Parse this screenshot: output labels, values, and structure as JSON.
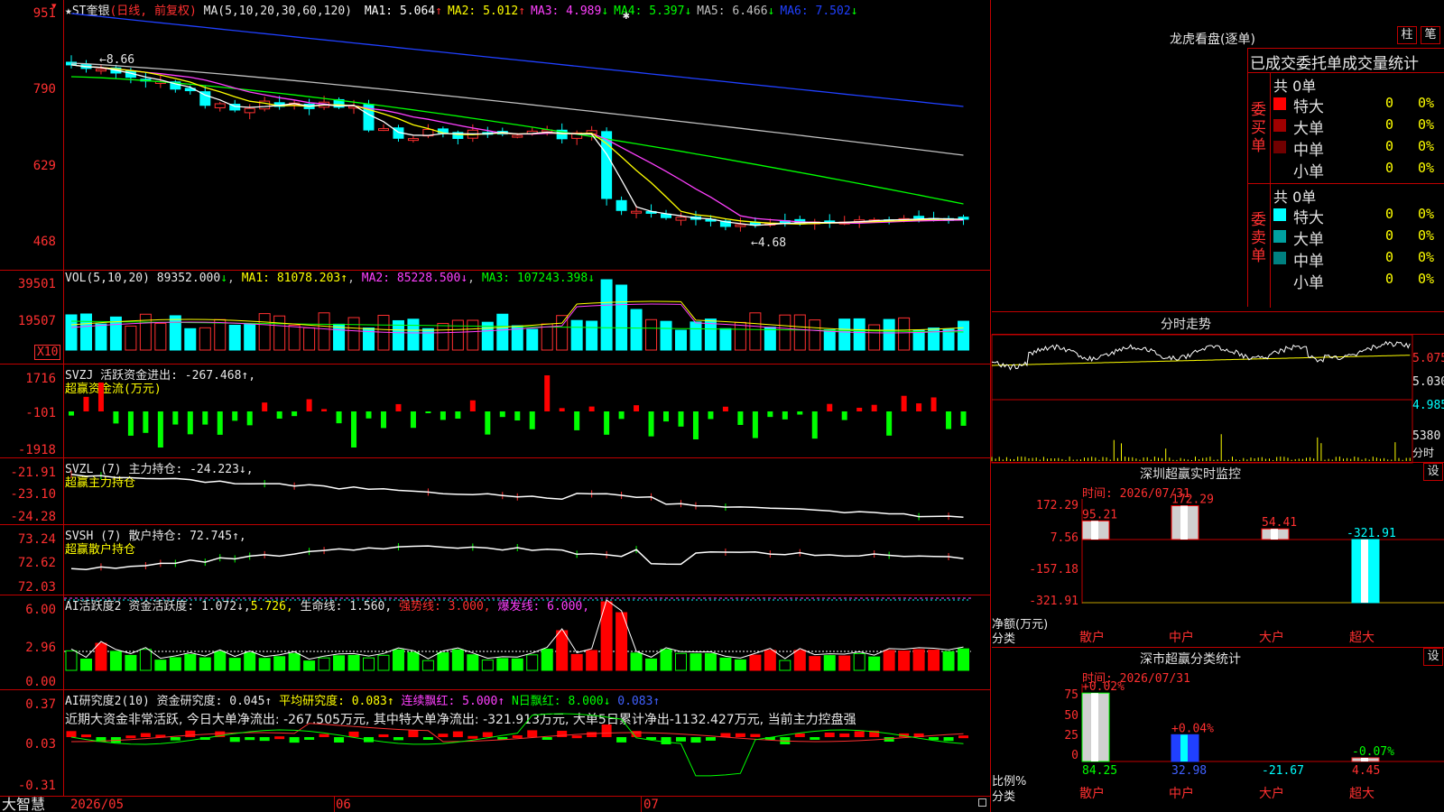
{
  "main_chart": {
    "stock_name": "★ST奎银",
    "period_tag": "(日线, 前复权)",
    "ma_params": "MA(5,10,20,30,60,120)",
    "ma_values": [
      {
        "label": "MA1:",
        "value": "5.064",
        "arrow": "↑",
        "color": "#ffffff"
      },
      {
        "label": "MA2:",
        "value": "5.012",
        "arrow": "↑",
        "color": "#ffff00"
      },
      {
        "label": "MA3:",
        "value": "4.989",
        "arrow": "↓",
        "color": "#ff40ff"
      },
      {
        "label": "MA4:",
        "value": "5.397",
        "arrow": "↓",
        "color": "#00ff00"
      },
      {
        "label": "MA5:",
        "value": "6.466",
        "arrow": "↓",
        "color": "#c0c0c0"
      },
      {
        "label": "MA6:",
        "value": "7.502",
        "arrow": "↓",
        "color": "#2040ff"
      }
    ],
    "y_ticks": [
      "951",
      "790",
      "629",
      "468"
    ],
    "high_label": "8.66",
    "low_label": "4.68",
    "star_marker": "✱"
  },
  "vol_panel": {
    "title": "VOL(5,10,20)",
    "value": "89352.000",
    "arrow": "↓",
    "ma1": "MA1: 81078.203↑",
    "ma2": "MA2: 85228.500↓",
    "ma3": "MA3: 107243.398↓",
    "y_ticks": [
      "39501",
      "19507"
    ],
    "unit": "X10"
  },
  "svzj_panel": {
    "title": "SVZJ",
    "desc": "活跃资金进出: -267.468↑,",
    "sub": "超赢资金流(万元)",
    "y_ticks": [
      "1716",
      "-101",
      "-1918"
    ]
  },
  "svzl_panel": {
    "title": "SVZL (7)",
    "desc": "主力持仓: -24.223↓,",
    "sub": "超赢主力持仓",
    "y_ticks": [
      "-21.91",
      "-23.10",
      "-24.28"
    ]
  },
  "svsh_panel": {
    "title": "SVSH (7)",
    "desc": "散户持仓: 72.745↑,",
    "sub": "超赢散户持仓",
    "y_ticks": [
      "73.24",
      "72.62",
      "72.03"
    ]
  },
  "ai_active_panel": {
    "title": "AI活跃度2",
    "desc1": "资金活跃度: 1.072↓,",
    "desc1b": "5.726,",
    "desc2": "生命线: 1.560,",
    "desc3": "强势线: 3.000,",
    "desc4": "爆发线: 6.000,",
    "y_ticks": [
      "6.00",
      "2.96",
      "0.00"
    ]
  },
  "ai_research_panel": {
    "title": "AI研究度2(10)",
    "desc1": "资金研究度: 0.045↑",
    "desc2": "平均研究度: 0.083↑",
    "desc3": "连续飘红: 5.000↑",
    "desc4": "N日飘红: 8.000↓",
    "desc5": "0.083↑",
    "summary": "近期大资金非常活跃, 今日大单净流出: -267.505万元, 其中特大单净流出: -321.913万元, 大单5日累计净出-1132.427万元, 当前主力控盘强",
    "y_ticks": [
      "0.37",
      "0.03",
      "-0.31"
    ]
  },
  "bottom_bar": {
    "logo": "大智慧",
    "dates": [
      "2026/05",
      "06",
      "07"
    ]
  },
  "right_panel": {
    "lhb_title": "龙虎看盘(逐单)",
    "btn_zhu": "柱",
    "btn_bi": "笔",
    "stat_header": "已成交委托单成交量统计",
    "buy_label": "委买单",
    "sell_label": "委卖单",
    "buy_total": "共 0单",
    "sell_total": "共 0单",
    "buy_rows": [
      {
        "name": "特大",
        "count": "0",
        "pct": "0%",
        "color": "#ff0000"
      },
      {
        "name": "大单",
        "count": "0",
        "pct": "0%",
        "color": "#a00000"
      },
      {
        "name": "中单",
        "count": "0",
        "pct": "0%",
        "color": "#700000"
      },
      {
        "name": "小单",
        "count": "0",
        "pct": "0%",
        "color": "#000000"
      }
    ],
    "sell_rows": [
      {
        "name": "特大",
        "count": "0",
        "pct": "0%",
        "color": "#00ffff"
      },
      {
        "name": "大单",
        "count": "0",
        "pct": "0%",
        "color": "#00a0a0"
      },
      {
        "name": "中单",
        "count": "0",
        "pct": "0%",
        "color": "#008080"
      },
      {
        "name": "小单",
        "count": "0",
        "pct": "0%",
        "color": "#000000"
      }
    ],
    "intraday_title": "分时走势",
    "intraday_ticks": [
      "5.075",
      "5.030",
      "4.985"
    ],
    "intraday_vol": "5380",
    "intraday_vol_label": "分时",
    "monitor_title": "深圳超赢实时监控",
    "monitor_btn": "设",
    "monitor_time": "时间: 2026/07/31",
    "monitor_yticks": [
      "172.29",
      "7.56",
      "-157.18",
      "-321.91"
    ],
    "monitor_unit1": "净额(万元)",
    "monitor_unit2": "分类",
    "monitor_bars": [
      {
        "cat": "散户",
        "value": "95.21"
      },
      {
        "cat": "中户",
        "value": "172.29"
      },
      {
        "cat": "大户",
        "value": "54.41"
      },
      {
        "cat": "超大",
        "value": "-321.91"
      }
    ],
    "class_title": "深市超赢分类统计",
    "class_btn": "设",
    "class_time": "时间: 2026/07/31",
    "class_yticks": [
      "75",
      "50",
      "25",
      "0"
    ],
    "class_unit1": "比例%",
    "class_unit2": "分类",
    "class_bars": [
      {
        "cat": "散户",
        "value": "84.25",
        "delta": "+0.02%"
      },
      {
        "cat": "中户",
        "value": "32.98",
        "delta": "+0.04%"
      },
      {
        "cat": "大户",
        "value": "-21.67",
        "delta": ""
      },
      {
        "cat": "超大",
        "value": "4.45",
        "delta": "-0.07%"
      }
    ]
  }
}
